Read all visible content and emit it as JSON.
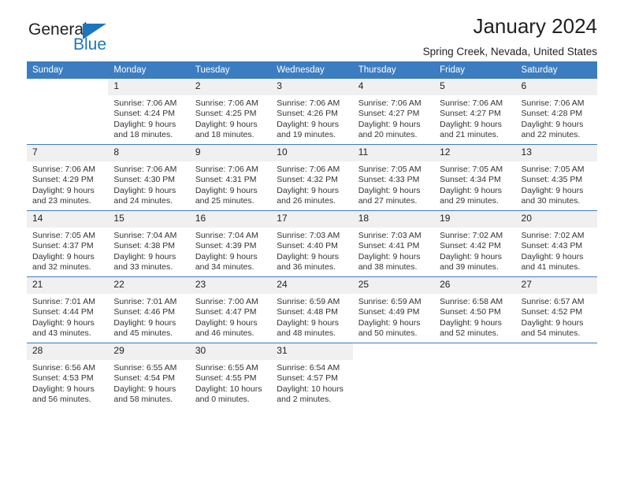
{
  "logo": {
    "word_top": "General",
    "word_bottom": "Blue",
    "triangle_icon": "triangle-icon",
    "accent_color": "#1d76bc"
  },
  "header": {
    "title": "January 2024",
    "subtitle": "Spring Creek, Nevada, United States"
  },
  "calendar": {
    "header_color": "#3b7dc0",
    "weekdays": [
      "Sunday",
      "Monday",
      "Tuesday",
      "Wednesday",
      "Thursday",
      "Friday",
      "Saturday"
    ],
    "weeks": [
      [
        {
          "day": "",
          "empty": true
        },
        {
          "day": "1",
          "sunrise": "Sunrise: 7:06 AM",
          "sunset": "Sunset: 4:24 PM",
          "daylight1": "Daylight: 9 hours",
          "daylight2": "and 18 minutes."
        },
        {
          "day": "2",
          "sunrise": "Sunrise: 7:06 AM",
          "sunset": "Sunset: 4:25 PM",
          "daylight1": "Daylight: 9 hours",
          "daylight2": "and 18 minutes."
        },
        {
          "day": "3",
          "sunrise": "Sunrise: 7:06 AM",
          "sunset": "Sunset: 4:26 PM",
          "daylight1": "Daylight: 9 hours",
          "daylight2": "and 19 minutes."
        },
        {
          "day": "4",
          "sunrise": "Sunrise: 7:06 AM",
          "sunset": "Sunset: 4:27 PM",
          "daylight1": "Daylight: 9 hours",
          "daylight2": "and 20 minutes."
        },
        {
          "day": "5",
          "sunrise": "Sunrise: 7:06 AM",
          "sunset": "Sunset: 4:27 PM",
          "daylight1": "Daylight: 9 hours",
          "daylight2": "and 21 minutes."
        },
        {
          "day": "6",
          "sunrise": "Sunrise: 7:06 AM",
          "sunset": "Sunset: 4:28 PM",
          "daylight1": "Daylight: 9 hours",
          "daylight2": "and 22 minutes."
        }
      ],
      [
        {
          "day": "7",
          "sunrise": "Sunrise: 7:06 AM",
          "sunset": "Sunset: 4:29 PM",
          "daylight1": "Daylight: 9 hours",
          "daylight2": "and 23 minutes."
        },
        {
          "day": "8",
          "sunrise": "Sunrise: 7:06 AM",
          "sunset": "Sunset: 4:30 PM",
          "daylight1": "Daylight: 9 hours",
          "daylight2": "and 24 minutes."
        },
        {
          "day": "9",
          "sunrise": "Sunrise: 7:06 AM",
          "sunset": "Sunset: 4:31 PM",
          "daylight1": "Daylight: 9 hours",
          "daylight2": "and 25 minutes."
        },
        {
          "day": "10",
          "sunrise": "Sunrise: 7:06 AM",
          "sunset": "Sunset: 4:32 PM",
          "daylight1": "Daylight: 9 hours",
          "daylight2": "and 26 minutes."
        },
        {
          "day": "11",
          "sunrise": "Sunrise: 7:05 AM",
          "sunset": "Sunset: 4:33 PM",
          "daylight1": "Daylight: 9 hours",
          "daylight2": "and 27 minutes."
        },
        {
          "day": "12",
          "sunrise": "Sunrise: 7:05 AM",
          "sunset": "Sunset: 4:34 PM",
          "daylight1": "Daylight: 9 hours",
          "daylight2": "and 29 minutes."
        },
        {
          "day": "13",
          "sunrise": "Sunrise: 7:05 AM",
          "sunset": "Sunset: 4:35 PM",
          "daylight1": "Daylight: 9 hours",
          "daylight2": "and 30 minutes."
        }
      ],
      [
        {
          "day": "14",
          "sunrise": "Sunrise: 7:05 AM",
          "sunset": "Sunset: 4:37 PM",
          "daylight1": "Daylight: 9 hours",
          "daylight2": "and 32 minutes."
        },
        {
          "day": "15",
          "sunrise": "Sunrise: 7:04 AM",
          "sunset": "Sunset: 4:38 PM",
          "daylight1": "Daylight: 9 hours",
          "daylight2": "and 33 minutes."
        },
        {
          "day": "16",
          "sunrise": "Sunrise: 7:04 AM",
          "sunset": "Sunset: 4:39 PM",
          "daylight1": "Daylight: 9 hours",
          "daylight2": "and 34 minutes."
        },
        {
          "day": "17",
          "sunrise": "Sunrise: 7:03 AM",
          "sunset": "Sunset: 4:40 PM",
          "daylight1": "Daylight: 9 hours",
          "daylight2": "and 36 minutes."
        },
        {
          "day": "18",
          "sunrise": "Sunrise: 7:03 AM",
          "sunset": "Sunset: 4:41 PM",
          "daylight1": "Daylight: 9 hours",
          "daylight2": "and 38 minutes."
        },
        {
          "day": "19",
          "sunrise": "Sunrise: 7:02 AM",
          "sunset": "Sunset: 4:42 PM",
          "daylight1": "Daylight: 9 hours",
          "daylight2": "and 39 minutes."
        },
        {
          "day": "20",
          "sunrise": "Sunrise: 7:02 AM",
          "sunset": "Sunset: 4:43 PM",
          "daylight1": "Daylight: 9 hours",
          "daylight2": "and 41 minutes."
        }
      ],
      [
        {
          "day": "21",
          "sunrise": "Sunrise: 7:01 AM",
          "sunset": "Sunset: 4:44 PM",
          "daylight1": "Daylight: 9 hours",
          "daylight2": "and 43 minutes."
        },
        {
          "day": "22",
          "sunrise": "Sunrise: 7:01 AM",
          "sunset": "Sunset: 4:46 PM",
          "daylight1": "Daylight: 9 hours",
          "daylight2": "and 45 minutes."
        },
        {
          "day": "23",
          "sunrise": "Sunrise: 7:00 AM",
          "sunset": "Sunset: 4:47 PM",
          "daylight1": "Daylight: 9 hours",
          "daylight2": "and 46 minutes."
        },
        {
          "day": "24",
          "sunrise": "Sunrise: 6:59 AM",
          "sunset": "Sunset: 4:48 PM",
          "daylight1": "Daylight: 9 hours",
          "daylight2": "and 48 minutes."
        },
        {
          "day": "25",
          "sunrise": "Sunrise: 6:59 AM",
          "sunset": "Sunset: 4:49 PM",
          "daylight1": "Daylight: 9 hours",
          "daylight2": "and 50 minutes."
        },
        {
          "day": "26",
          "sunrise": "Sunrise: 6:58 AM",
          "sunset": "Sunset: 4:50 PM",
          "daylight1": "Daylight: 9 hours",
          "daylight2": "and 52 minutes."
        },
        {
          "day": "27",
          "sunrise": "Sunrise: 6:57 AM",
          "sunset": "Sunset: 4:52 PM",
          "daylight1": "Daylight: 9 hours",
          "daylight2": "and 54 minutes."
        }
      ],
      [
        {
          "day": "28",
          "sunrise": "Sunrise: 6:56 AM",
          "sunset": "Sunset: 4:53 PM",
          "daylight1": "Daylight: 9 hours",
          "daylight2": "and 56 minutes."
        },
        {
          "day": "29",
          "sunrise": "Sunrise: 6:55 AM",
          "sunset": "Sunset: 4:54 PM",
          "daylight1": "Daylight: 9 hours",
          "daylight2": "and 58 minutes."
        },
        {
          "day": "30",
          "sunrise": "Sunrise: 6:55 AM",
          "sunset": "Sunset: 4:55 PM",
          "daylight1": "Daylight: 10 hours",
          "daylight2": "and 0 minutes."
        },
        {
          "day": "31",
          "sunrise": "Sunrise: 6:54 AM",
          "sunset": "Sunset: 4:57 PM",
          "daylight1": "Daylight: 10 hours",
          "daylight2": "and 2 minutes."
        },
        {
          "day": "",
          "empty": true
        },
        {
          "day": "",
          "empty": true
        },
        {
          "day": "",
          "empty": true
        }
      ]
    ]
  }
}
